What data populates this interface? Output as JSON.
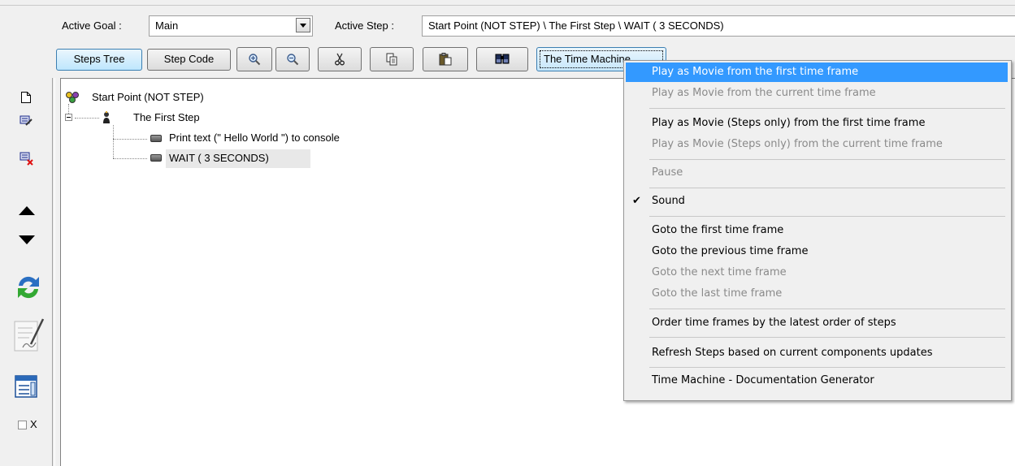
{
  "toolbar": {
    "active_goal_label": "Active Goal :",
    "active_goal_value": "Main",
    "active_step_label": "Active Step :",
    "active_step_value": "Start Point (NOT STEP) \\ The First Step \\ WAIT ( 3 SECONDS)",
    "steps_tree_label": "Steps Tree",
    "step_code_label": "Step Code",
    "zoom_in_icon": "zoom-in-icon",
    "zoom_out_icon": "zoom-out-icon",
    "cut_icon": "cut-icon",
    "copy_icon": "copy-icon",
    "paste_icon": "paste-icon",
    "find_icon": "find-icon",
    "time_machine_label": "The Time Machine"
  },
  "sidebar": {
    "items": [
      {
        "icon": "new-file-icon"
      },
      {
        "icon": "edit-step-icon"
      },
      {
        "icon": "delete-step-icon"
      },
      {
        "icon": "move-up-icon"
      },
      {
        "icon": "move-down-icon"
      },
      {
        "icon": "refresh-icon"
      },
      {
        "icon": "notes-icon"
      },
      {
        "icon": "window-icon"
      }
    ],
    "checkbox_label": "X"
  },
  "tree": {
    "root": "Start Point (NOT STEP)",
    "step": "The First Step",
    "children": [
      "Print text (\" Hello World \") to console",
      "WAIT ( 3 SECONDS)"
    ]
  },
  "menu": {
    "items": [
      {
        "label": "Play as Movie from the first time frame",
        "state": "highlighted"
      },
      {
        "label": "Play as Movie from the current time frame",
        "state": "disabled"
      },
      {
        "label": "Play as Movie (Steps only) from the first time frame",
        "state": "enabled"
      },
      {
        "label": "Play as Movie (Steps only) from the current time frame",
        "state": "disabled"
      },
      {
        "label": "Pause",
        "state": "disabled"
      },
      {
        "label": "Sound",
        "state": "checked"
      },
      {
        "label": "Goto the first time frame",
        "state": "enabled"
      },
      {
        "label": "Goto the previous time frame",
        "state": "enabled"
      },
      {
        "label": "Goto the next time frame",
        "state": "disabled"
      },
      {
        "label": "Goto the last time frame",
        "state": "disabled"
      },
      {
        "label": "Order time frames by the latest order of steps",
        "state": "enabled"
      },
      {
        "label": "Refresh Steps based on current components updates",
        "state": "enabled"
      },
      {
        "label": "Time Machine - Documentation Generator",
        "state": "enabled"
      }
    ]
  },
  "colors": {
    "menu_highlight": "#3399ff",
    "disabled_text": "#8a8a8a",
    "active_button": "#bee6fd"
  }
}
